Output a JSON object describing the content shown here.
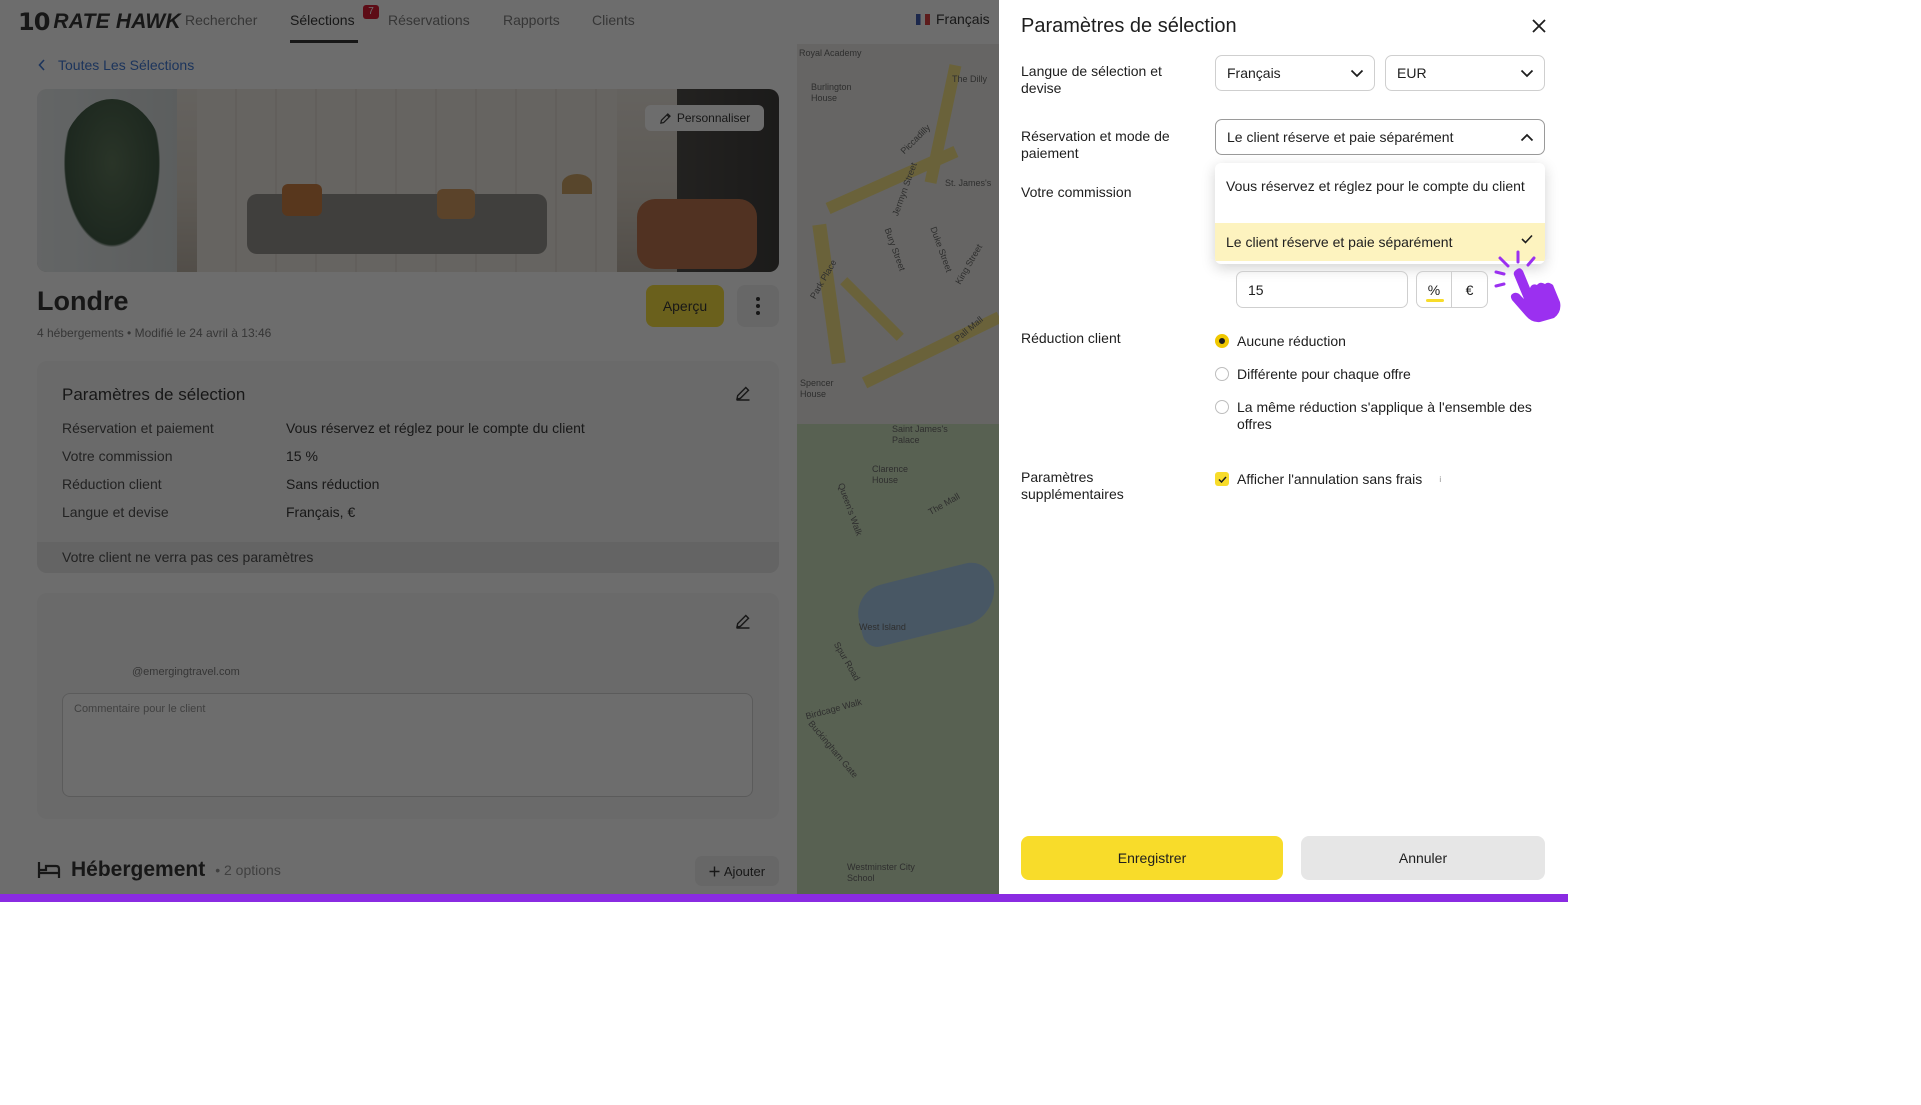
{
  "header": {
    "brand_mark": "10",
    "brand_name": "RATE HAWK",
    "nav": [
      "Rechercher",
      "Sélections",
      "Réservations",
      "Rapports",
      "Clients"
    ],
    "badge_count": "7",
    "language": "Français"
  },
  "breadcrumb": "Toutes Les Sélections",
  "hero": {
    "customize_label": "Personnaliser"
  },
  "selection": {
    "title": "Londre",
    "subtitle": "4 hébergements • Modifié le 24 avril à 13:46",
    "preview_label": "Aperçu"
  },
  "params_card": {
    "title": "Paramètres de sélection",
    "rows": [
      {
        "label": "Réservation et paiement",
        "value": "Vous réservez et réglez pour le compte du client"
      },
      {
        "label": "Votre commission",
        "value": "15 %"
      },
      {
        "label": "Réduction client",
        "value": "Sans réduction"
      },
      {
        "label": "Langue et devise",
        "value": "Français, €"
      }
    ],
    "footer": "Votre client ne verra pas ces paramètres"
  },
  "contact_card": {
    "email": "@emergingtravel.com",
    "comment_placeholder": "Commentaire pour le client"
  },
  "accommodation": {
    "title": "Hébergement",
    "count": "• 2 options",
    "add_label": "Ajouter"
  },
  "map_labels": [
    "Royal Academy",
    "Burlington House",
    "The Dilly",
    "Piccadilly",
    "St. James's",
    "Jermyn Street",
    "Duke Street",
    "Bury Street",
    "King Street",
    "Park Place",
    "Pall Mall",
    "Spencer House",
    "Saint James's Palace",
    "Clarence House",
    "The Mall",
    "West Island",
    "Birdcage Walk",
    "Buckingham Gate",
    "Westminster City School",
    "Queen's Walk",
    "Spur Road"
  ],
  "panel": {
    "title": "Paramètres de sélection",
    "lang_label": "Langue de sélection et devise",
    "lang_value": "Français",
    "currency_value": "EUR",
    "booking_label": "Réservation et mode de paiement",
    "booking_value": "Le client réserve et paie séparément",
    "dropdown_options": [
      "Vous réservez et réglez pour le compte du client",
      "Le client réserve et paie séparément"
    ],
    "commission_label": "Votre commission",
    "commission_value": "15",
    "unit_percent": "%",
    "unit_euro": "€",
    "discount_label": "Réduction client",
    "discount_options": [
      "Aucune réduction",
      "Différente pour chaque offre",
      "La même réduction s'applique à l'ensemble des offres"
    ],
    "extra_label": "Paramètres supplémentaires",
    "extra_option": "Afficher l'annulation sans frais",
    "save_label": "Enregistrer",
    "cancel_label": "Annuler"
  },
  "colors": {
    "accent": "#f8dc2a",
    "link": "#2a6bd1",
    "badge": "#d6001c",
    "bottom_bar": "#8a2be2"
  }
}
